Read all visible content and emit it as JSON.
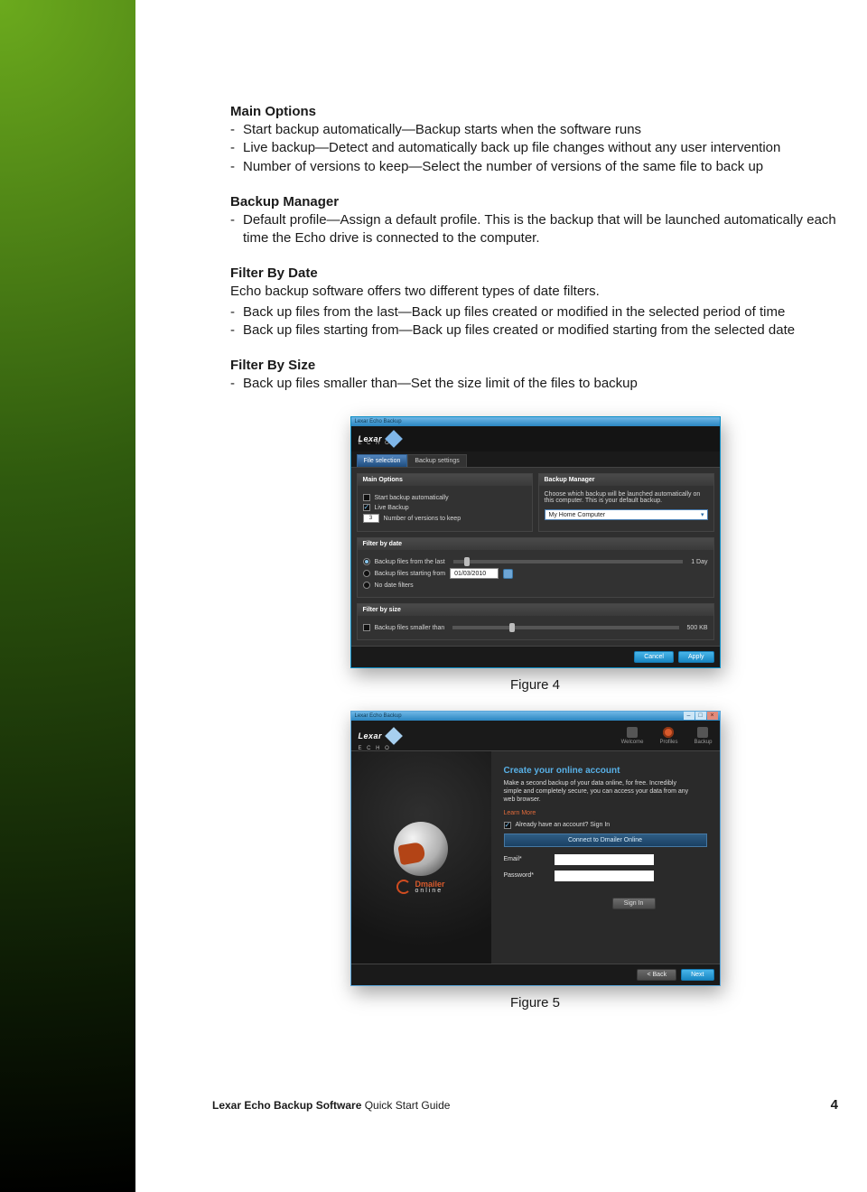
{
  "sections": {
    "main_options": {
      "heading": "Main Options",
      "bullets": [
        "Start backup automatically—Backup starts when the software runs",
        "Live backup—Detect and automatically back up file changes without any user intervention",
        "Number of versions to keep—Select the number of versions of the same file to back up"
      ]
    },
    "backup_manager": {
      "heading": "Backup Manager",
      "bullets": [
        "Default profile—Assign a default profile. This is the backup that will be launched automatically each time the Echo drive is connected to the computer."
      ]
    },
    "filter_by_date": {
      "heading": "Filter By Date",
      "intro": "Echo backup software offers two different types of date filters.",
      "bullets": [
        "Back up files from the last—Back up files created or modified in the selected period of time",
        "Back up files starting from—Back up files created or modified starting from the selected date"
      ]
    },
    "filter_by_size": {
      "heading": "Filter By Size",
      "bullets": [
        "Back up files smaller than—Set the size limit of the files to backup"
      ]
    }
  },
  "figure4": {
    "caption": "Figure 4",
    "titlebar": "Lexar Echo Backup",
    "logo_main": "Lexar",
    "logo_sub": "E C H O",
    "tabs": {
      "file_selection": "File selection",
      "backup_settings": "Backup settings"
    },
    "main_options": {
      "title": "Main Options",
      "start_auto": "Start backup automatically",
      "live_backup": "Live Backup",
      "versions_value": "3",
      "versions_label": "Number of versions to keep"
    },
    "backup_manager": {
      "title": "Backup Manager",
      "desc": "Choose which backup will be launched automatically on this computer. This is your default backup.",
      "dropdown": "My Home Computer"
    },
    "filter_by_date": {
      "title": "Filter by date",
      "last_label": "Backup files from the last",
      "last_value": "1 Day",
      "from_label": "Backup files starting from",
      "from_value": "01/03/2010",
      "none_label": "No date filters"
    },
    "filter_by_size": {
      "title": "Filter by size",
      "label": "Backup files smaller than",
      "value": "500 KB"
    },
    "buttons": {
      "cancel": "Cancel",
      "apply": "Apply"
    }
  },
  "figure5": {
    "caption": "Figure 5",
    "titlebar": "Lexar Echo Backup",
    "logo_main": "Lexar",
    "logo_sub": "E C H O",
    "header_icons": {
      "welcome": "Welcome",
      "profiles": "Profiles",
      "backup": "Backup"
    },
    "brand": {
      "name": "Dmailer",
      "sub": "online"
    },
    "create": {
      "heading": "Create your online account",
      "desc": "Make a second backup of your data online, for free. Incredibly simple and completely secure, you can access your data from any web browser.",
      "learn_more": "Learn More",
      "already": "Already have an account? Sign In",
      "connect": "Connect to Dmailer Online",
      "email_label": "Email*",
      "password_label": "Password*",
      "signin": "Sign In"
    },
    "buttons": {
      "back": "< Back",
      "next": "Next"
    }
  },
  "footer": {
    "bold": "Lexar Echo Backup Software",
    "rest": " Quick Start Guide",
    "page": "4"
  }
}
